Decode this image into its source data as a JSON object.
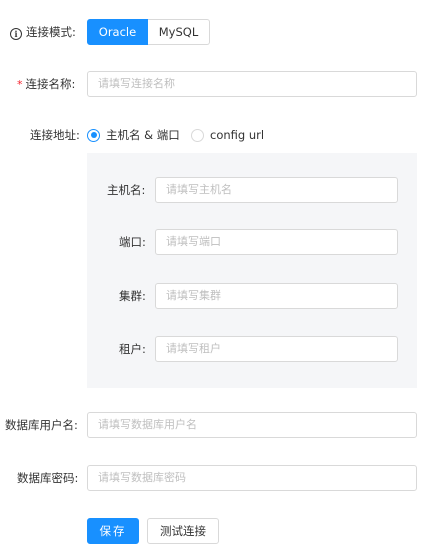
{
  "form": {
    "mode": {
      "label": "连接模式",
      "colon": ":",
      "info_icon": "info-circle-icon",
      "options": [
        "Oracle",
        "MySQL"
      ],
      "selected": "Oracle"
    },
    "name": {
      "required_mark": "*",
      "label": "连接名称",
      "colon": ":",
      "placeholder": "请填写连接名称"
    },
    "address": {
      "label": "连接地址",
      "colon": ":",
      "options": [
        "主机名 & 端口",
        "config url"
      ],
      "selected": "主机名 & 端口"
    },
    "host_panel": {
      "host": {
        "label": "主机名",
        "colon": ":",
        "placeholder": "请填写主机名"
      },
      "port": {
        "label": "端口",
        "colon": ":",
        "placeholder": "请填写端口"
      },
      "cluster": {
        "label": "集群",
        "colon": ":",
        "placeholder": "请填写集群"
      },
      "tenant": {
        "label": "租户",
        "colon": ":",
        "placeholder": "请填写租户"
      }
    },
    "db_user": {
      "label": "数据库用户名",
      "colon": ":",
      "placeholder": "请填写数据库用户名"
    },
    "db_password": {
      "label": "数据库密码",
      "colon": ":",
      "placeholder": "请填写数据库密码"
    },
    "actions": {
      "save_label": "保存",
      "test_label": "测试连接"
    }
  },
  "colors": {
    "primary": "#1890ff",
    "required": "#f5222d",
    "panel_bg": "#f5f6f8",
    "border": "#d9d9d9",
    "placeholder": "#bfbfbf"
  }
}
